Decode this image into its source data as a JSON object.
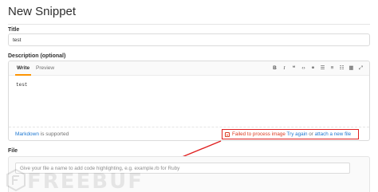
{
  "page": {
    "title": "New Snippet"
  },
  "title_field": {
    "label": "Title",
    "value": "test"
  },
  "description": {
    "label": "Description (optional)",
    "tabs": [
      "Write",
      "Preview"
    ],
    "toolbar": [
      "bold-icon",
      "italic-icon",
      "quote-icon",
      "code-icon",
      "link-icon",
      "bulleted-list-icon",
      "numbered-list-icon",
      "task-list-icon",
      "table-icon",
      "fullscreen-icon"
    ],
    "body_text": "test",
    "markdown_link": "Markdown",
    "markdown_suffix": " is supported",
    "error": {
      "message": "Failed to process image",
      "try_again": "Try again",
      "or": " or ",
      "attach": "attach a new file"
    }
  },
  "file": {
    "label": "File",
    "placeholder": "Give your file a name to add code highlighting, e.g. example.rb for Ruby"
  },
  "watermark": "FREEBUF",
  "colors": {
    "error": "#db3b21",
    "link": "#1f78d1",
    "tab_accent": "#fc9403",
    "arrow": "#e02020"
  }
}
